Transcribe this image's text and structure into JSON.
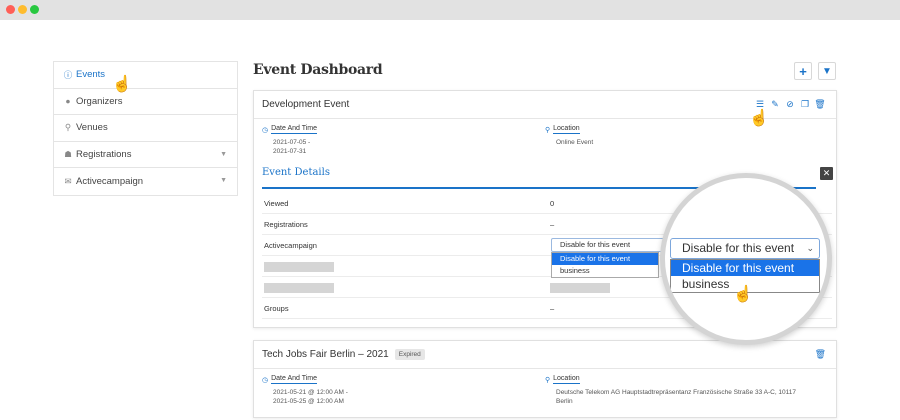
{
  "sidebar": {
    "items": [
      {
        "label": "Events",
        "icon": "info-circle-icon"
      },
      {
        "label": "Organizers",
        "icon": "user-icon"
      },
      {
        "label": "Venues",
        "icon": "map-pin-icon"
      },
      {
        "label": "Registrations",
        "icon": "users-icon"
      },
      {
        "label": "Activecampaign",
        "icon": "envelope-icon"
      }
    ]
  },
  "header": {
    "title": "Event Dashboard",
    "add_label": "+",
    "filter_label": "▼"
  },
  "event1": {
    "title": "Development Event",
    "date_label": "Date And Time",
    "date_start": "2021-07-05 -",
    "date_end": "2021-07-31",
    "location_label": "Location",
    "location_value": "Online Event",
    "details_title": "Event Details",
    "close_label": "✕",
    "rows": {
      "viewed_label": "Viewed",
      "viewed_value": "0",
      "registrations_label": "Registrations",
      "registrations_value": "–",
      "activecampaign_label": "Activecampaign",
      "groups_label": "Groups",
      "groups_value": "–"
    },
    "select": {
      "selected": "Disable for this event",
      "options": [
        "Disable for this event",
        "business"
      ]
    }
  },
  "event2": {
    "title": "Tech Jobs Fair Berlin – 2021",
    "badge": "Expired",
    "date_label": "Date And Time",
    "date_start": "2021-05-21 @ 12:00 AM -",
    "date_end": "2021-05-25 @ 12:00 AM",
    "location_label": "Location",
    "location_line1": "Deutsche Telekom AG Hauptstadtrepräsentanz Französische Straße 33 A-C, 10117",
    "location_line2": "Berlin"
  },
  "colors": {
    "accent": "#1a73c8",
    "selected_option": "#1a73e8"
  }
}
